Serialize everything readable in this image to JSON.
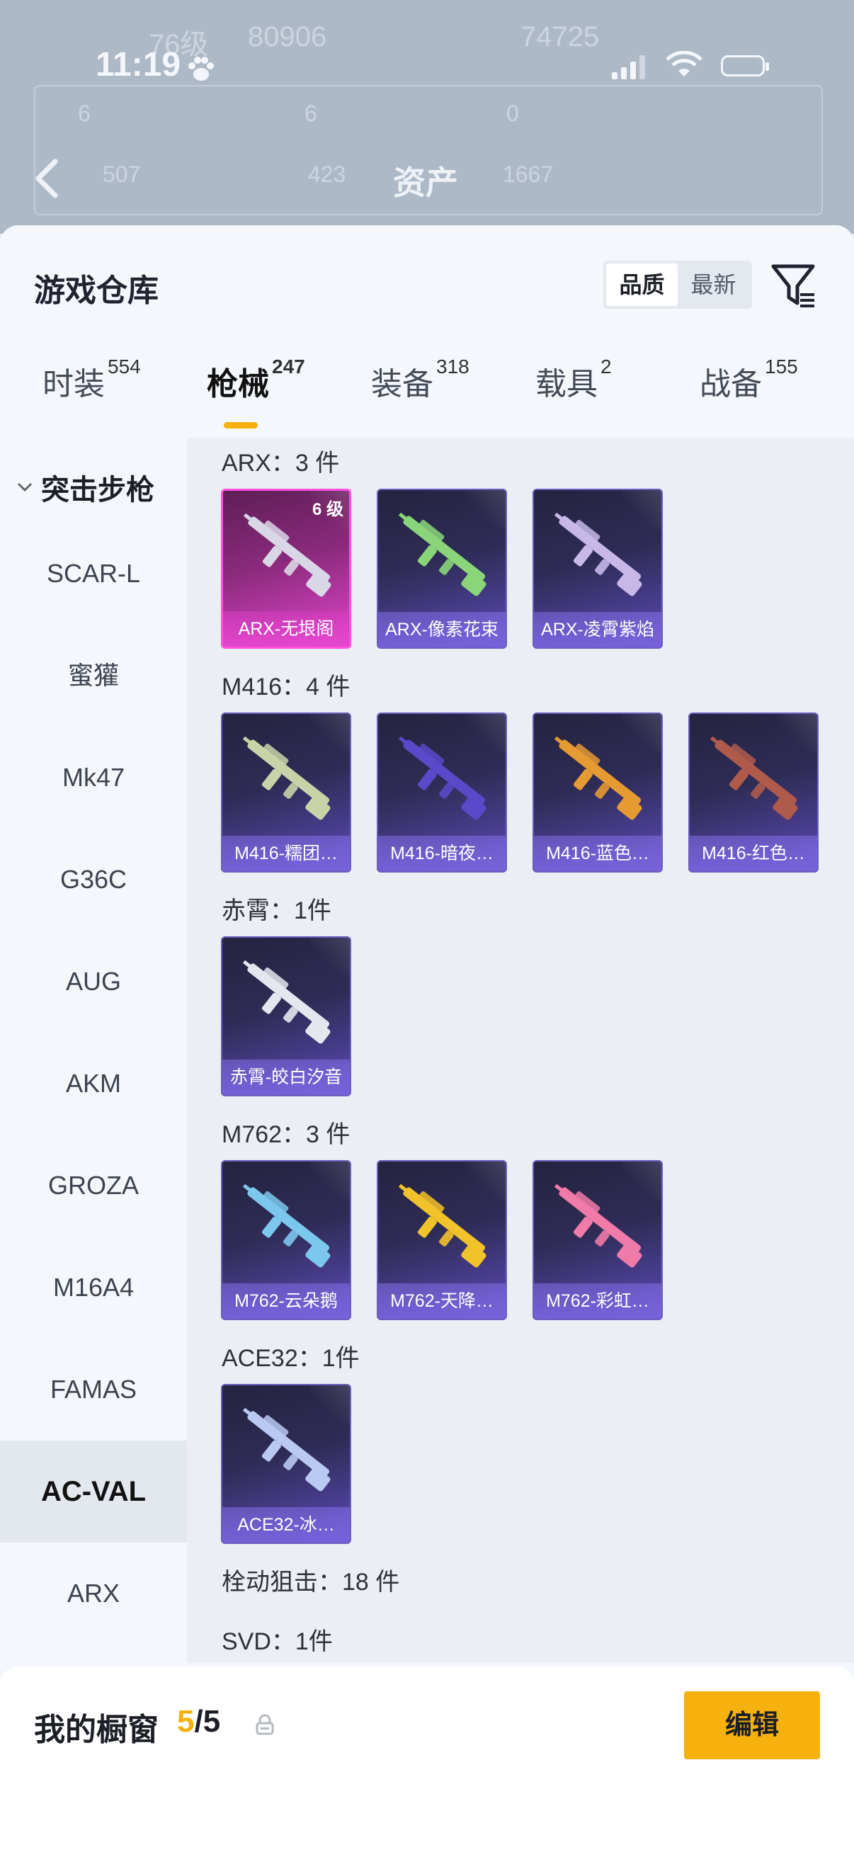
{
  "status_bar": {
    "time": "11:19"
  },
  "background_page": {
    "title": "资产",
    "ghost_texts": [
      "76级",
      "80906",
      "74725",
      "6",
      "6",
      "0",
      "507",
      "423",
      "1667"
    ]
  },
  "sheet": {
    "title": "游戏仓库",
    "sort_options": [
      "品质",
      "最新"
    ],
    "active_sort": "品质"
  },
  "tabs": [
    {
      "label": "时装",
      "count": "554"
    },
    {
      "label": "枪械",
      "count": "247",
      "active": true
    },
    {
      "label": "装备",
      "count": "318"
    },
    {
      "label": "载具",
      "count": "2"
    },
    {
      "label": "战备",
      "count": "155"
    }
  ],
  "sidebar": {
    "category": "突击步枪",
    "items": [
      "SCAR-L",
      "蜜獾",
      "Mk47",
      "G36C",
      "AUG",
      "AKM",
      "GROZA",
      "M16A4",
      "FAMAS",
      "AC-VAL",
      "ARX"
    ],
    "active_item": "AC-VAL"
  },
  "groups": [
    {
      "title": "ARX：3 件",
      "items": [
        {
          "label": "ARX-无垠阁",
          "level": "6 级",
          "quality": "pink",
          "gun_color": "#d9d6e6"
        },
        {
          "label": "ARX-像素花束",
          "quality": "purple",
          "gun_color": "#8ad57a"
        },
        {
          "label": "ARX-凌霄紫焰",
          "quality": "purple",
          "gun_color": "#c7b8e8"
        }
      ]
    },
    {
      "title": "M416：4 件",
      "items": [
        {
          "label": "M416-糯团…",
          "quality": "purple",
          "gun_color": "#c9d3a8"
        },
        {
          "label": "M416-暗夜…",
          "quality": "purple",
          "gun_color": "#5a49c8"
        },
        {
          "label": "M416-蓝色…",
          "quality": "purple",
          "gun_color": "#e59a32"
        },
        {
          "label": "M416-红色…",
          "quality": "purple",
          "gun_color": "#b05a4c"
        }
      ]
    },
    {
      "title": "赤霄：1件",
      "items": [
        {
          "label": "赤霄-皎白汐音",
          "quality": "purple",
          "gun_color": "#e6e6ee"
        }
      ]
    },
    {
      "title": "M762：3 件",
      "items": [
        {
          "label": "M762-云朵鹅",
          "quality": "purple",
          "gun_color": "#7cc7ee"
        },
        {
          "label": "M762-天降…",
          "quality": "purple",
          "gun_color": "#f2c22a"
        },
        {
          "label": "M762-彩虹…",
          "quality": "purple",
          "gun_color": "#f07aa8"
        }
      ]
    },
    {
      "title": "ACE32：1件",
      "items": [
        {
          "label": "ACE32-冰…",
          "quality": "purple",
          "gun_color": "#b9c9f2"
        }
      ]
    },
    {
      "title": "栓动狙击：18 件",
      "items": []
    },
    {
      "title": "SVD：1件",
      "items": []
    }
  ],
  "showcase": {
    "title": "我的橱窗",
    "current": "5",
    "total": "/5"
  },
  "edit_label": "编辑",
  "colors": {
    "accent": "#f6b10e",
    "purple_card": "#4c3f95",
    "pink_card": "#c13cae"
  },
  "icons": [
    "paw-icon",
    "signal-icon",
    "wifi-icon",
    "battery-icon",
    "back-arrow-icon",
    "filter-icon",
    "chevron-down-icon",
    "share-icon",
    "lock-icon",
    "gun-icon"
  ]
}
